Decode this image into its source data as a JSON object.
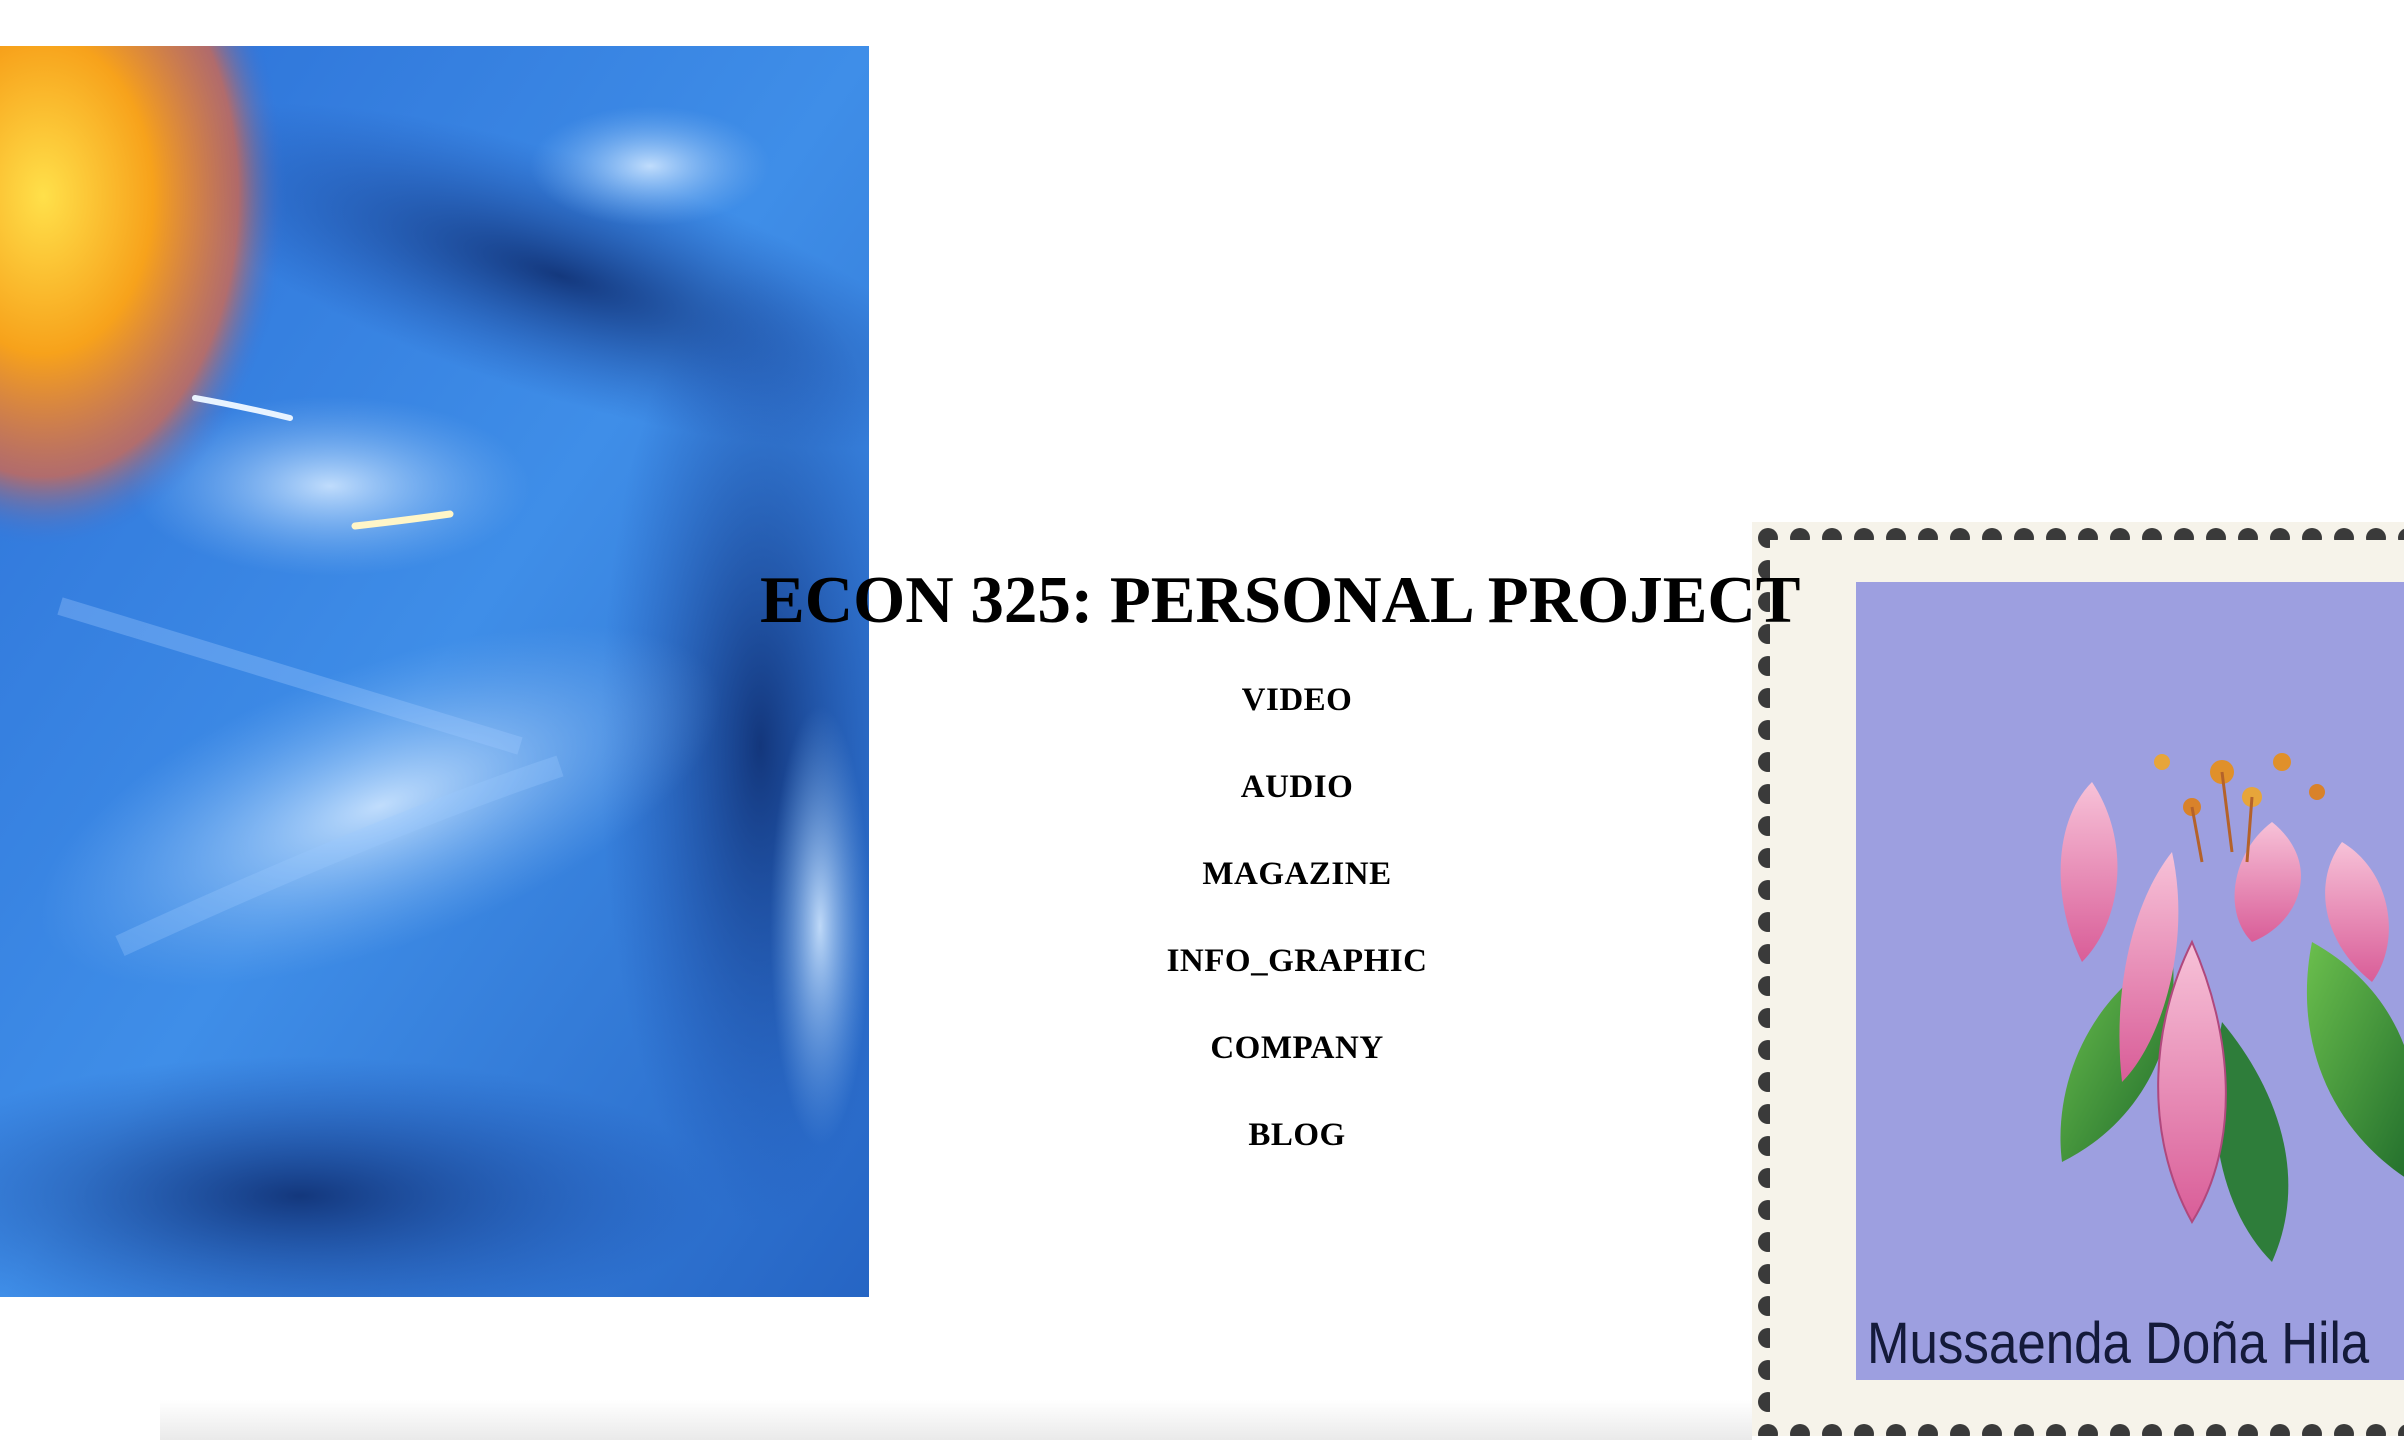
{
  "page": {
    "title": "ECON 325: PERSONAL PROJECT"
  },
  "nav": {
    "items": [
      {
        "label": "VIDEO"
      },
      {
        "label": "AUDIO"
      },
      {
        "label": "MAGAZINE"
      },
      {
        "label": "INFO_GRAPHIC"
      },
      {
        "label": "COMPANY"
      },
      {
        "label": "BLOG"
      }
    ]
  },
  "images": {
    "left": {
      "name": "blue-face-photo"
    },
    "right": {
      "name": "flower-stamp",
      "caption": "Mussaenda Doña Hila"
    }
  },
  "colors": {
    "text": "#000000",
    "background": "#ffffff",
    "photo_blue": "#2f7ad9",
    "photo_orange": "#f7a21b",
    "stamp_lilac": "#9d9fe0",
    "stamp_pink": "#e57fb0",
    "stamp_leaf": "#2f8a3a"
  }
}
